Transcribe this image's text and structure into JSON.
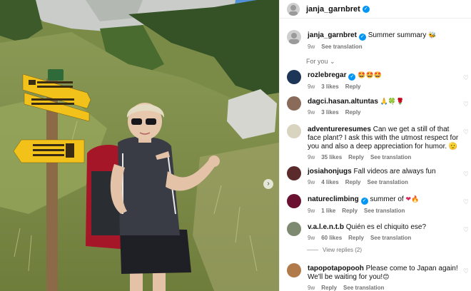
{
  "post": {
    "author": "janja_garnbret",
    "caption": "Summer summary",
    "caption_emoji": "🐝",
    "age": "9w",
    "see_translation": "See translation"
  },
  "section_label": "For you",
  "next_icon": "chevron-right-icon",
  "comments": [
    {
      "user": "rozlebregar",
      "verified": true,
      "text": "",
      "emoji": "🤩🤩🤩",
      "age": "9w",
      "likes": "3 likes",
      "reply": "Reply",
      "translation": "",
      "avatar_color": "#1d3556"
    },
    {
      "user": "dagci.hasan.altuntas",
      "verified": false,
      "text": "",
      "emoji": "🙏🍀🌹",
      "age": "9w",
      "likes": "3 likes",
      "reply": "Reply",
      "translation": "",
      "avatar_color": "#8a6b5a"
    },
    {
      "user": "adventureresumes",
      "verified": false,
      "text": "Can we get a still of that face plant? I ask this with the utmost respect for you and also a deep appreciation for humor. 🫡",
      "emoji": "",
      "age": "9w",
      "likes": "35 likes",
      "reply": "Reply",
      "translation": "See translation",
      "avatar_color": "#d9d4c0"
    },
    {
      "user": "josiahonjugs",
      "verified": false,
      "text": "Fall videos are always fun",
      "emoji": "",
      "age": "9w",
      "likes": "4 likes",
      "reply": "Reply",
      "translation": "See translation",
      "avatar_color": "#5b2a2a"
    },
    {
      "user": "natureclimbing",
      "verified": true,
      "text": "summer of",
      "emoji": "❤🔥",
      "age": "9w",
      "likes": "1 like",
      "reply": "Reply",
      "translation": "See translation",
      "avatar_color": "#6a1030"
    },
    {
      "user": "v.a.l.e.n.t.b",
      "verified": false,
      "text": "Quién es el chiquito ese?",
      "emoji": "",
      "age": "9w",
      "likes": "60 likes",
      "reply": "Reply",
      "translation": "See translation",
      "avatar_color": "#7d8a70"
    },
    {
      "user": "tapopotapopooh",
      "verified": false,
      "text": "Please come to Japan again! We'll be waiting for you!",
      "emoji": "😊",
      "age": "9w",
      "likes": "",
      "reply": "Reply",
      "translation": "See translation",
      "avatar_color": "#b07a4a"
    }
  ],
  "view_replies": "View replies (2)",
  "colors": {
    "verified": "#0095f6",
    "muted": "#737373",
    "sign_yellow": "#f2c21b"
  }
}
